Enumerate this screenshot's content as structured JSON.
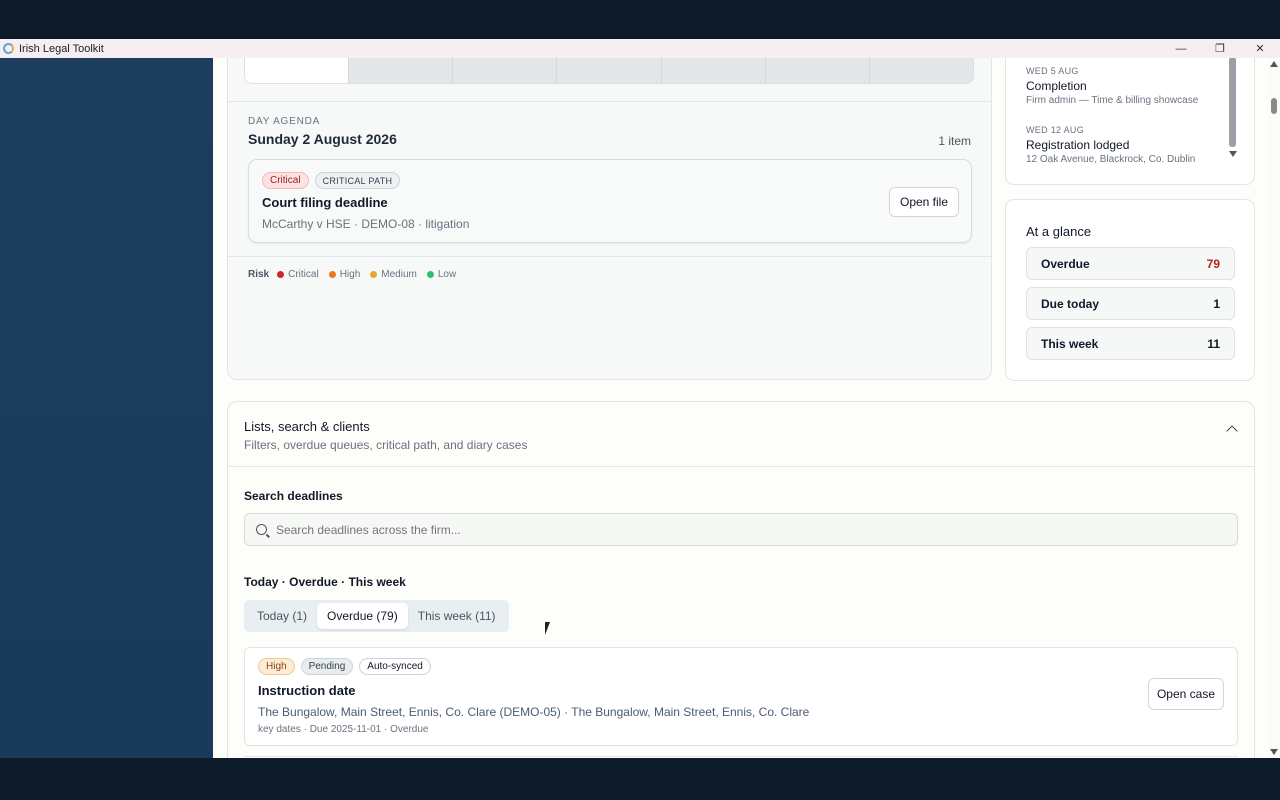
{
  "window": {
    "title": "Irish Legal Toolkit",
    "minimize_glyph": "—",
    "maximize_glyph": "❐",
    "close_glyph": "✕"
  },
  "calendar": {
    "agenda_kicker": "DAY AGENDA",
    "agenda_date": "Sunday 2 August 2026",
    "item_count": "1 item",
    "event": {
      "risk_label": "Critical",
      "path_label": "CRITICAL PATH",
      "title": "Court filing deadline",
      "meta": "McCarthy v HSE · DEMO-08 · litigation",
      "open_label": "Open file"
    },
    "legend": {
      "label": "Risk",
      "items": [
        {
          "label": "Critical",
          "color": "#d0242b"
        },
        {
          "label": "High",
          "color": "#ea7a1e"
        },
        {
          "label": "Medium",
          "color": "#e8a92b"
        },
        {
          "label": "Low",
          "color": "#2fbf71"
        }
      ]
    }
  },
  "upcoming": {
    "items": [
      {
        "date": "WED 5 AUG",
        "title": "Completion",
        "sub": "Firm admin — Time & billing showcase"
      },
      {
        "date": "WED 12 AUG",
        "title": "Registration lodged",
        "sub": "12 Oak Avenue, Blackrock, Co. Dublin"
      }
    ]
  },
  "glance": {
    "title": "At a glance",
    "rows": [
      {
        "label": "Overdue",
        "value": "79",
        "color": "#b42318"
      },
      {
        "label": "Due today",
        "value": "1",
        "color": "#111827"
      },
      {
        "label": "This week",
        "value": "11",
        "color": "#111827"
      }
    ]
  },
  "lists": {
    "title": "Lists, search & clients",
    "subtitle": "Filters, overdue queues, critical path, and diary cases",
    "search_label": "Search deadlines",
    "search_placeholder": "Search deadlines across the firm...",
    "quick_label": "Today · Overdue · This week",
    "tabs": [
      {
        "label": "Today (1)",
        "active": false
      },
      {
        "label": "Overdue (79)",
        "active": true
      },
      {
        "label": "This week (11)",
        "active": false
      }
    ],
    "result": {
      "risk_label": "High",
      "status_label": "Pending",
      "sync_label": "Auto-synced",
      "title": "Instruction date",
      "meta": "The Bungalow, Main Street, Ennis, Co. Clare (DEMO-05) · The Bungalow, Main Street, Ennis, Co. Clare",
      "sub": "key dates · Due 2025-11-01 · Overdue",
      "open_label": "Open case"
    }
  }
}
